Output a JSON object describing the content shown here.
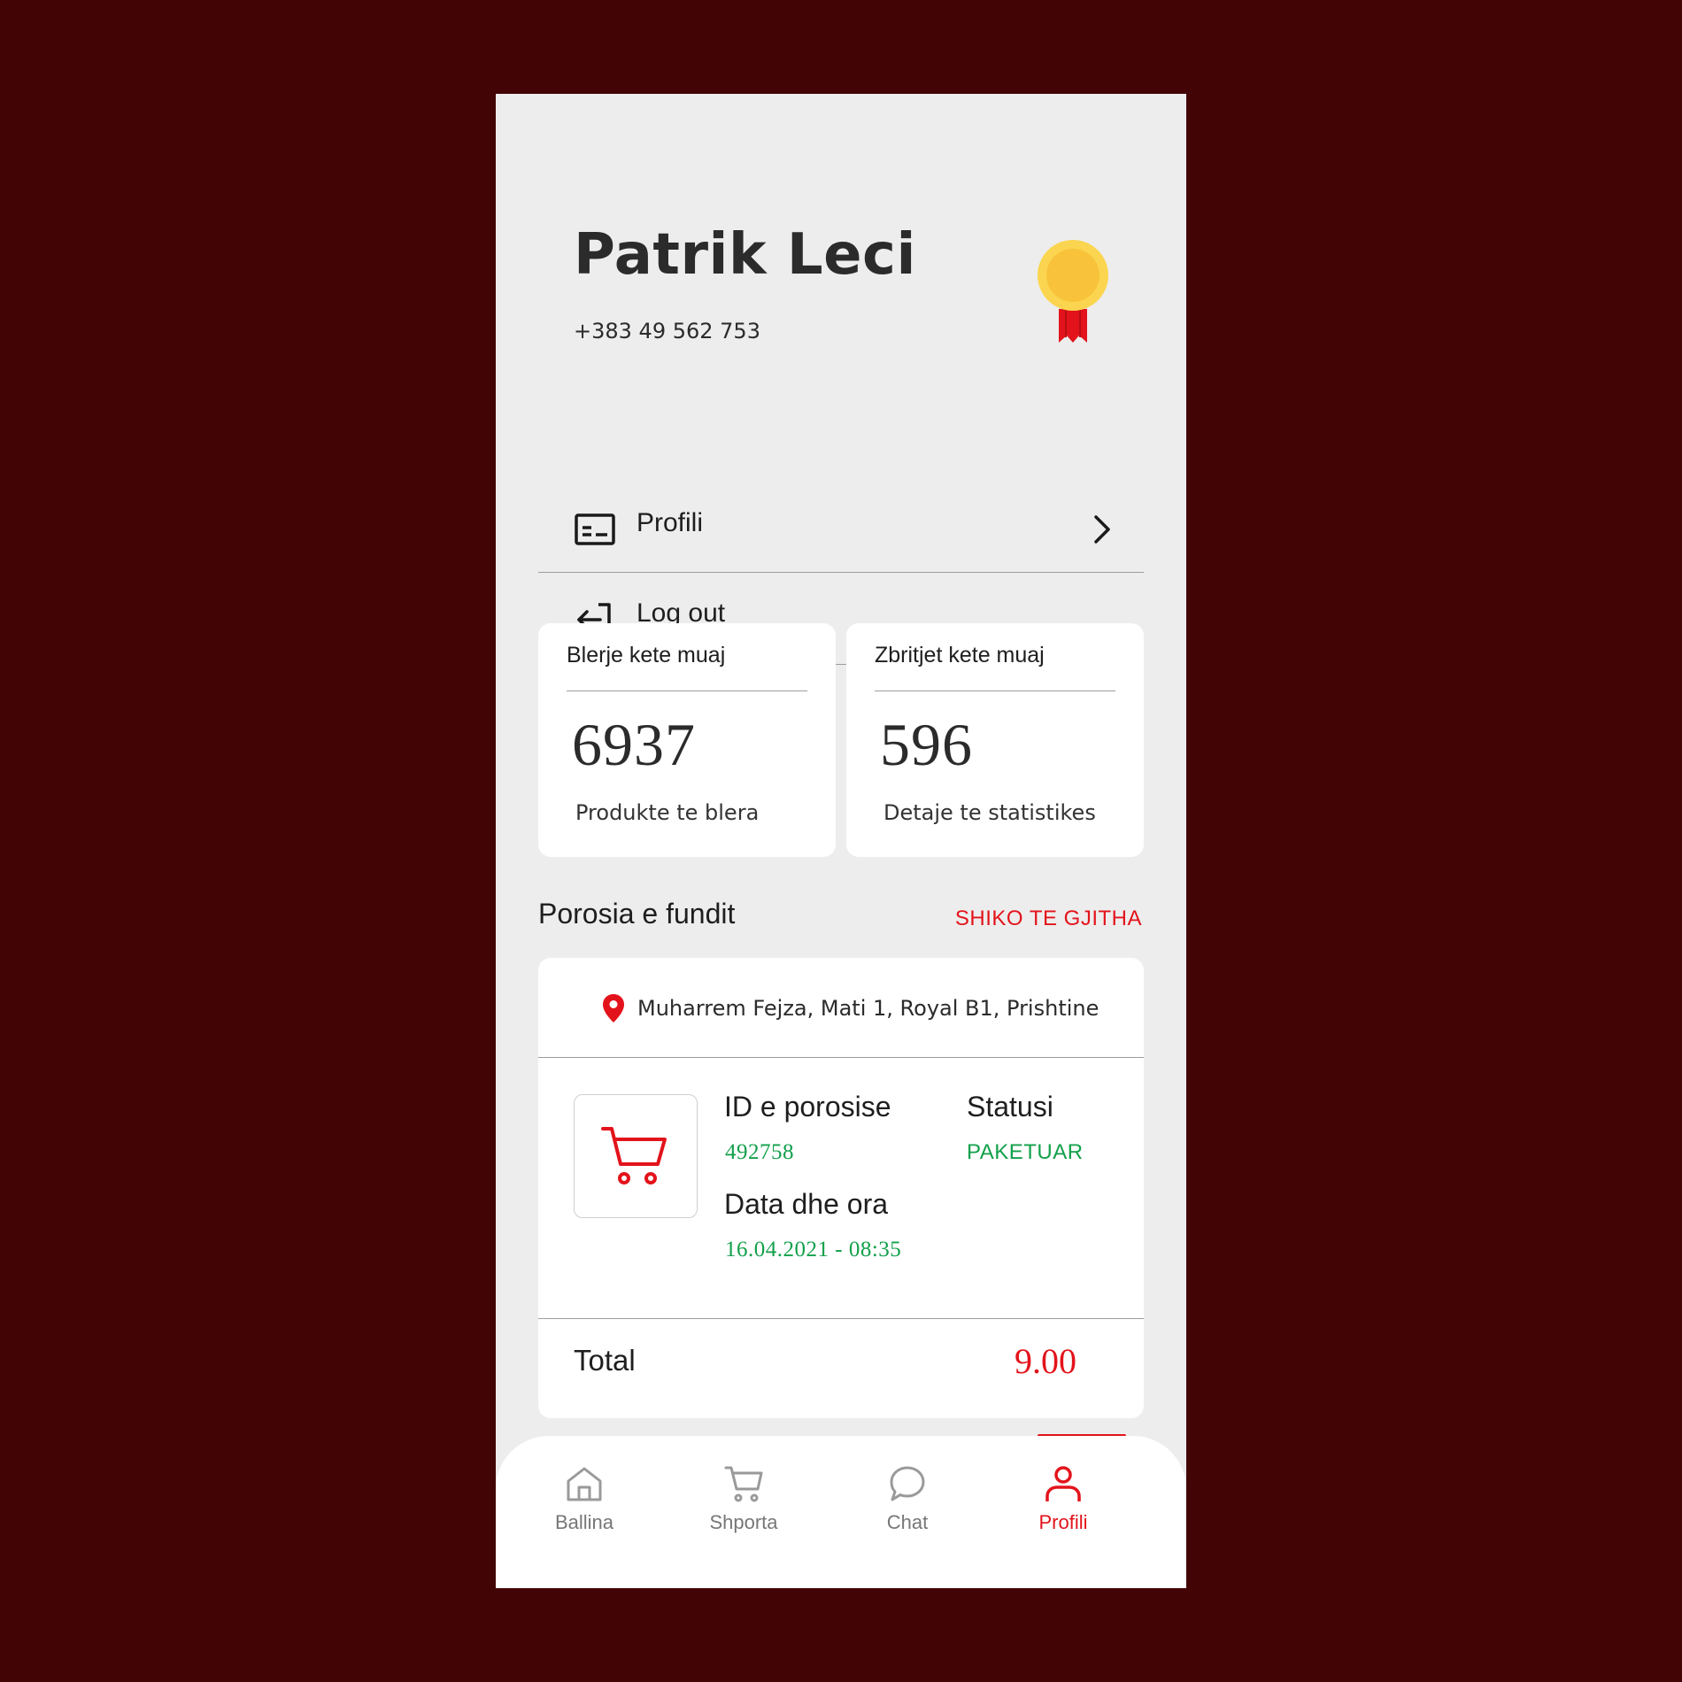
{
  "profile": {
    "name": "Patrik Leci",
    "phone": "+383 49 562 753"
  },
  "menu": [
    {
      "label": "Profili",
      "icon": "id-card-icon"
    },
    {
      "label": "Log out",
      "icon": "logout-icon"
    }
  ],
  "stats": [
    {
      "title": "Blerje kete muaj",
      "value": "6937",
      "subtitle": "Produkte te blera"
    },
    {
      "title": "Zbritjet kete muaj",
      "value": "596",
      "subtitle": "Detaje te statistikes"
    }
  ],
  "last_order": {
    "section_title": "Porosia e fundit",
    "see_all": "SHIKO TE GJITHA",
    "address": "Muharrem Fejza, Mati 1, Royal B1, Prishtine",
    "id_label": "ID e porosise",
    "id_value": "492758",
    "status_label": "Statusi",
    "status_value": "PAKETUAR",
    "date_label": "Data dhe ora",
    "date_value": "16.04.2021 - 08:35",
    "total_label": "Total",
    "total_value": "9.00"
  },
  "tabs": [
    {
      "label": "Ballina",
      "icon": "home-icon"
    },
    {
      "label": "Shporta",
      "icon": "cart-icon"
    },
    {
      "label": "Chat",
      "icon": "chat-icon"
    },
    {
      "label": "Profili",
      "icon": "user-icon",
      "active": true
    }
  ],
  "colors": {
    "accent": "#e3131b",
    "success": "#12a04a",
    "background": "#430406",
    "surface": "#ededed",
    "medal": "#fbc63a"
  }
}
